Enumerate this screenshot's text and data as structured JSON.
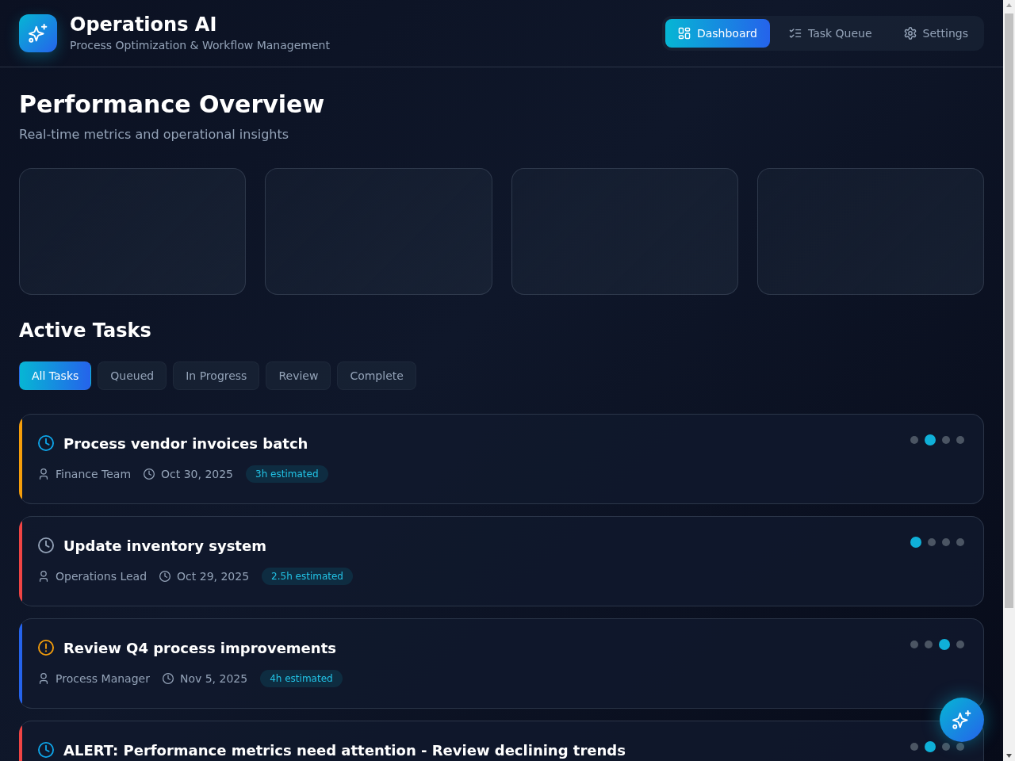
{
  "header": {
    "title": "Operations AI",
    "subtitle": "Process Optimization & Workflow Management"
  },
  "nav": [
    {
      "kind": "dashboard",
      "label": "Dashboard",
      "selected": true
    },
    {
      "kind": "queue",
      "label": "Task Queue",
      "selected": false
    },
    {
      "kind": "settings",
      "label": "Settings",
      "selected": false
    }
  ],
  "overview": {
    "title": "Performance Overview",
    "subtitle": "Real-time metrics and operational insights",
    "metric_cards": [
      {
        "loading": true
      },
      {
        "loading": true
      },
      {
        "loading": true
      },
      {
        "loading": true
      }
    ]
  },
  "tasks": {
    "title": "Active Tasks",
    "filters": [
      {
        "label": "All Tasks",
        "selected": true
      },
      {
        "label": "Queued",
        "selected": false
      },
      {
        "label": "In Progress",
        "selected": false
      },
      {
        "label": "Review",
        "selected": false
      },
      {
        "label": "Complete",
        "selected": false
      }
    ],
    "items": [
      {
        "kind": "active",
        "title": "Process vendor invoices batch",
        "color": "#f59e0b",
        "assignee": "Finance Team",
        "date": "Oct 30, 2025",
        "estimate": "3h estimated",
        "steps": [
          {
            "active": false
          },
          {
            "active": true
          },
          {
            "active": false
          },
          {
            "active": false
          }
        ]
      },
      {
        "kind": "queued",
        "title": "Update inventory system",
        "color": "#ef4444",
        "assignee": "Operations Lead",
        "date": "Oct 29, 2025",
        "estimate": "2.5h estimated",
        "steps": [
          {
            "active": true
          },
          {
            "active": false
          },
          {
            "active": false
          },
          {
            "active": false
          }
        ]
      },
      {
        "kind": "review",
        "title": "Review Q4 process improvements",
        "color": "#2563eb",
        "assignee": "Process Manager",
        "date": "Nov 5, 2025",
        "estimate": "4h estimated",
        "steps": [
          {
            "active": false
          },
          {
            "active": false
          },
          {
            "active": true
          },
          {
            "active": false
          }
        ]
      },
      {
        "kind": "active",
        "title": "ALERT: Performance metrics need attention - Review declining trends",
        "color": "#ef4444",
        "steps": [
          {
            "active": false
          },
          {
            "active": true
          },
          {
            "active": false
          },
          {
            "active": false
          }
        ]
      }
    ]
  }
}
